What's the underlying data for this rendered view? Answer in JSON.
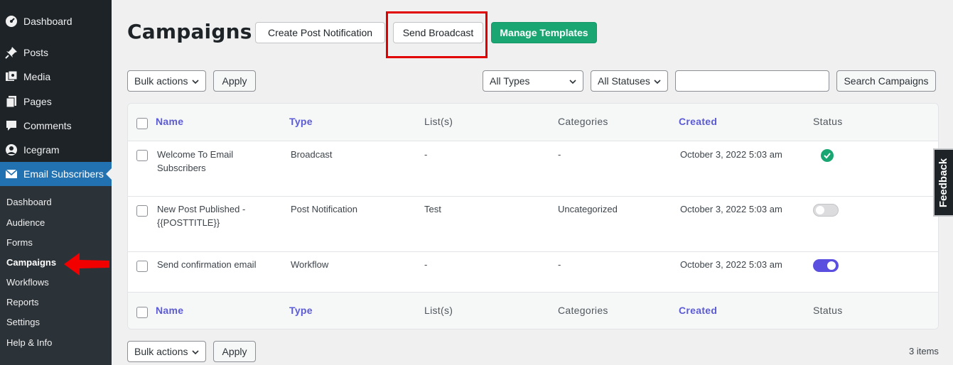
{
  "sidebar": {
    "items": [
      {
        "label": "Dashboard",
        "icon": "dashboard-icon"
      },
      {
        "label": "Posts",
        "icon": "pin-icon"
      },
      {
        "label": "Media",
        "icon": "media-icon"
      },
      {
        "label": "Pages",
        "icon": "pages-icon"
      },
      {
        "label": "Comments",
        "icon": "comment-icon"
      },
      {
        "label": "Icegram",
        "icon": "icegram-icon"
      },
      {
        "label": "Email Subscribers",
        "icon": "envelope-icon"
      }
    ],
    "submenu": [
      "Dashboard",
      "Audience",
      "Forms",
      "Campaigns",
      "Workflows",
      "Reports",
      "Settings",
      "Help & Info"
    ],
    "current_submenu": "Campaigns"
  },
  "header": {
    "title": "Campaigns",
    "create_post_notification": "Create Post Notification",
    "send_broadcast": "Send Broadcast",
    "manage_templates": "Manage Templates"
  },
  "filters": {
    "bulk_actions": "Bulk actions",
    "apply": "Apply",
    "types": "All Types",
    "statuses": "All Statuses",
    "search_value": "",
    "search_button": "Search Campaigns"
  },
  "table": {
    "columns": [
      "Name",
      "Type",
      "List(s)",
      "Categories",
      "Created",
      "Status"
    ],
    "rows": [
      {
        "name_line1": "Welcome To Email",
        "name_line2": "Subscribers",
        "type": "Broadcast",
        "lists": "-",
        "categories": "-",
        "created": "October 3, 2022 5:03 am",
        "status": "sent"
      },
      {
        "name_line1": "New Post Published -",
        "name_line2": "{{POSTTITLE}}",
        "type": "Post Notification",
        "lists": "Test",
        "categories": "Uncategorized",
        "created": "October 3, 2022 5:03 am",
        "status": "off"
      },
      {
        "name_line1": "Send confirmation email",
        "name_line2": "",
        "type": "Workflow",
        "lists": "-",
        "categories": "-",
        "created": "October 3, 2022 5:03 am",
        "status": "on"
      }
    ]
  },
  "footer": {
    "bulk_actions": "Bulk actions",
    "apply": "Apply",
    "items_count": "3 items"
  },
  "feedback_label": "Feedback",
  "colors": {
    "accent": "#2271b1",
    "green": "#1aa672",
    "link": "#5b5bd6",
    "highlight": "#e00000"
  }
}
